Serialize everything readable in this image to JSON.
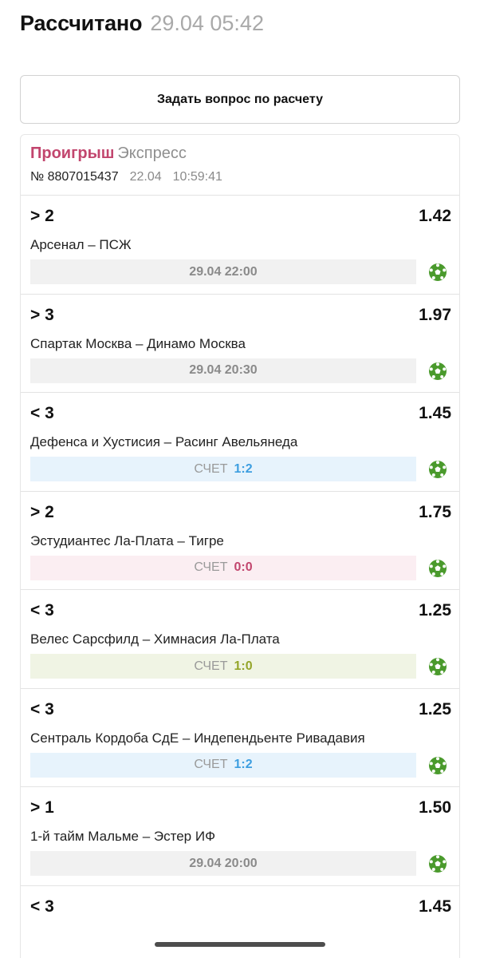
{
  "header": {
    "status": "Рассчитано",
    "time": "29.04 05:42"
  },
  "ask_button": {
    "label": "Задать вопрос по расчету"
  },
  "ticket": {
    "result": "Проигрыш",
    "type": "Экспресс",
    "number": "№ 8807015437",
    "date": "22.04",
    "time": "10:59:41"
  },
  "score_label": "СЧЕТ",
  "bets": [
    {
      "outcome": "> 2",
      "odds": "1.42",
      "match": "Арсенал – ПСЖ",
      "info": "29.04 22:00",
      "score": "",
      "style": "neutral"
    },
    {
      "outcome": "> 3",
      "odds": "1.97",
      "match": "Спартак Москва – Динамо Москва",
      "info": "29.04 20:30",
      "score": "",
      "style": "neutral"
    },
    {
      "outcome": "< 3",
      "odds": "1.45",
      "match": "Дефенса и Хустисия – Расинг Авельянеда",
      "info": "",
      "score": "1:2",
      "style": "blue"
    },
    {
      "outcome": "> 2",
      "odds": "1.75",
      "match": "Эстудиантес Ла-Плата – Тигре",
      "info": "",
      "score": "0:0",
      "style": "pink"
    },
    {
      "outcome": "< 3",
      "odds": "1.25",
      "match": "Велес Сарсфилд – Химнасия Ла-Плата",
      "info": "",
      "score": "1:0",
      "style": "olive"
    },
    {
      "outcome": "< 3",
      "odds": "1.25",
      "match": "Сентраль Кордоба СдЕ – Индепендьенте Ривадавия",
      "info": "",
      "score": "1:2",
      "style": "blue"
    },
    {
      "outcome": "> 1",
      "odds": "1.50",
      "match": "1-й тайм Мальме – Эстер ИФ",
      "info": "29.04 20:00",
      "score": "",
      "style": "neutral"
    },
    {
      "outcome": "< 3",
      "odds": "1.45",
      "match": "",
      "info": "",
      "score": "",
      "style": "neutral"
    }
  ],
  "icons": {
    "sport": "soccer-ball-icon"
  },
  "colors": {
    "loss": "#c2466e",
    "score_blue": "#3d9ee0",
    "score_olive": "#94a52a",
    "ball_green": "#4a9a2c"
  }
}
